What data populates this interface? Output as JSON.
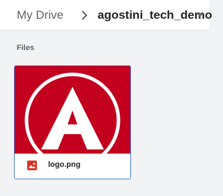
{
  "breadcrumb": {
    "root": "My Drive",
    "current": "agostini_tech_demo"
  },
  "icons": {
    "separator": "chevron-right-icon",
    "caret": "arrow-drop-down-icon",
    "file_type": "image-file-icon",
    "thumbnail": "angular-logo-thumbnail"
  },
  "files_section": {
    "label": "Files",
    "items": [
      {
        "name": "logo.png"
      }
    ]
  },
  "colors": {
    "selection_border": "#4d7bd6",
    "thumbnail_bg": "#c3001e",
    "image_icon": "#d93025"
  }
}
